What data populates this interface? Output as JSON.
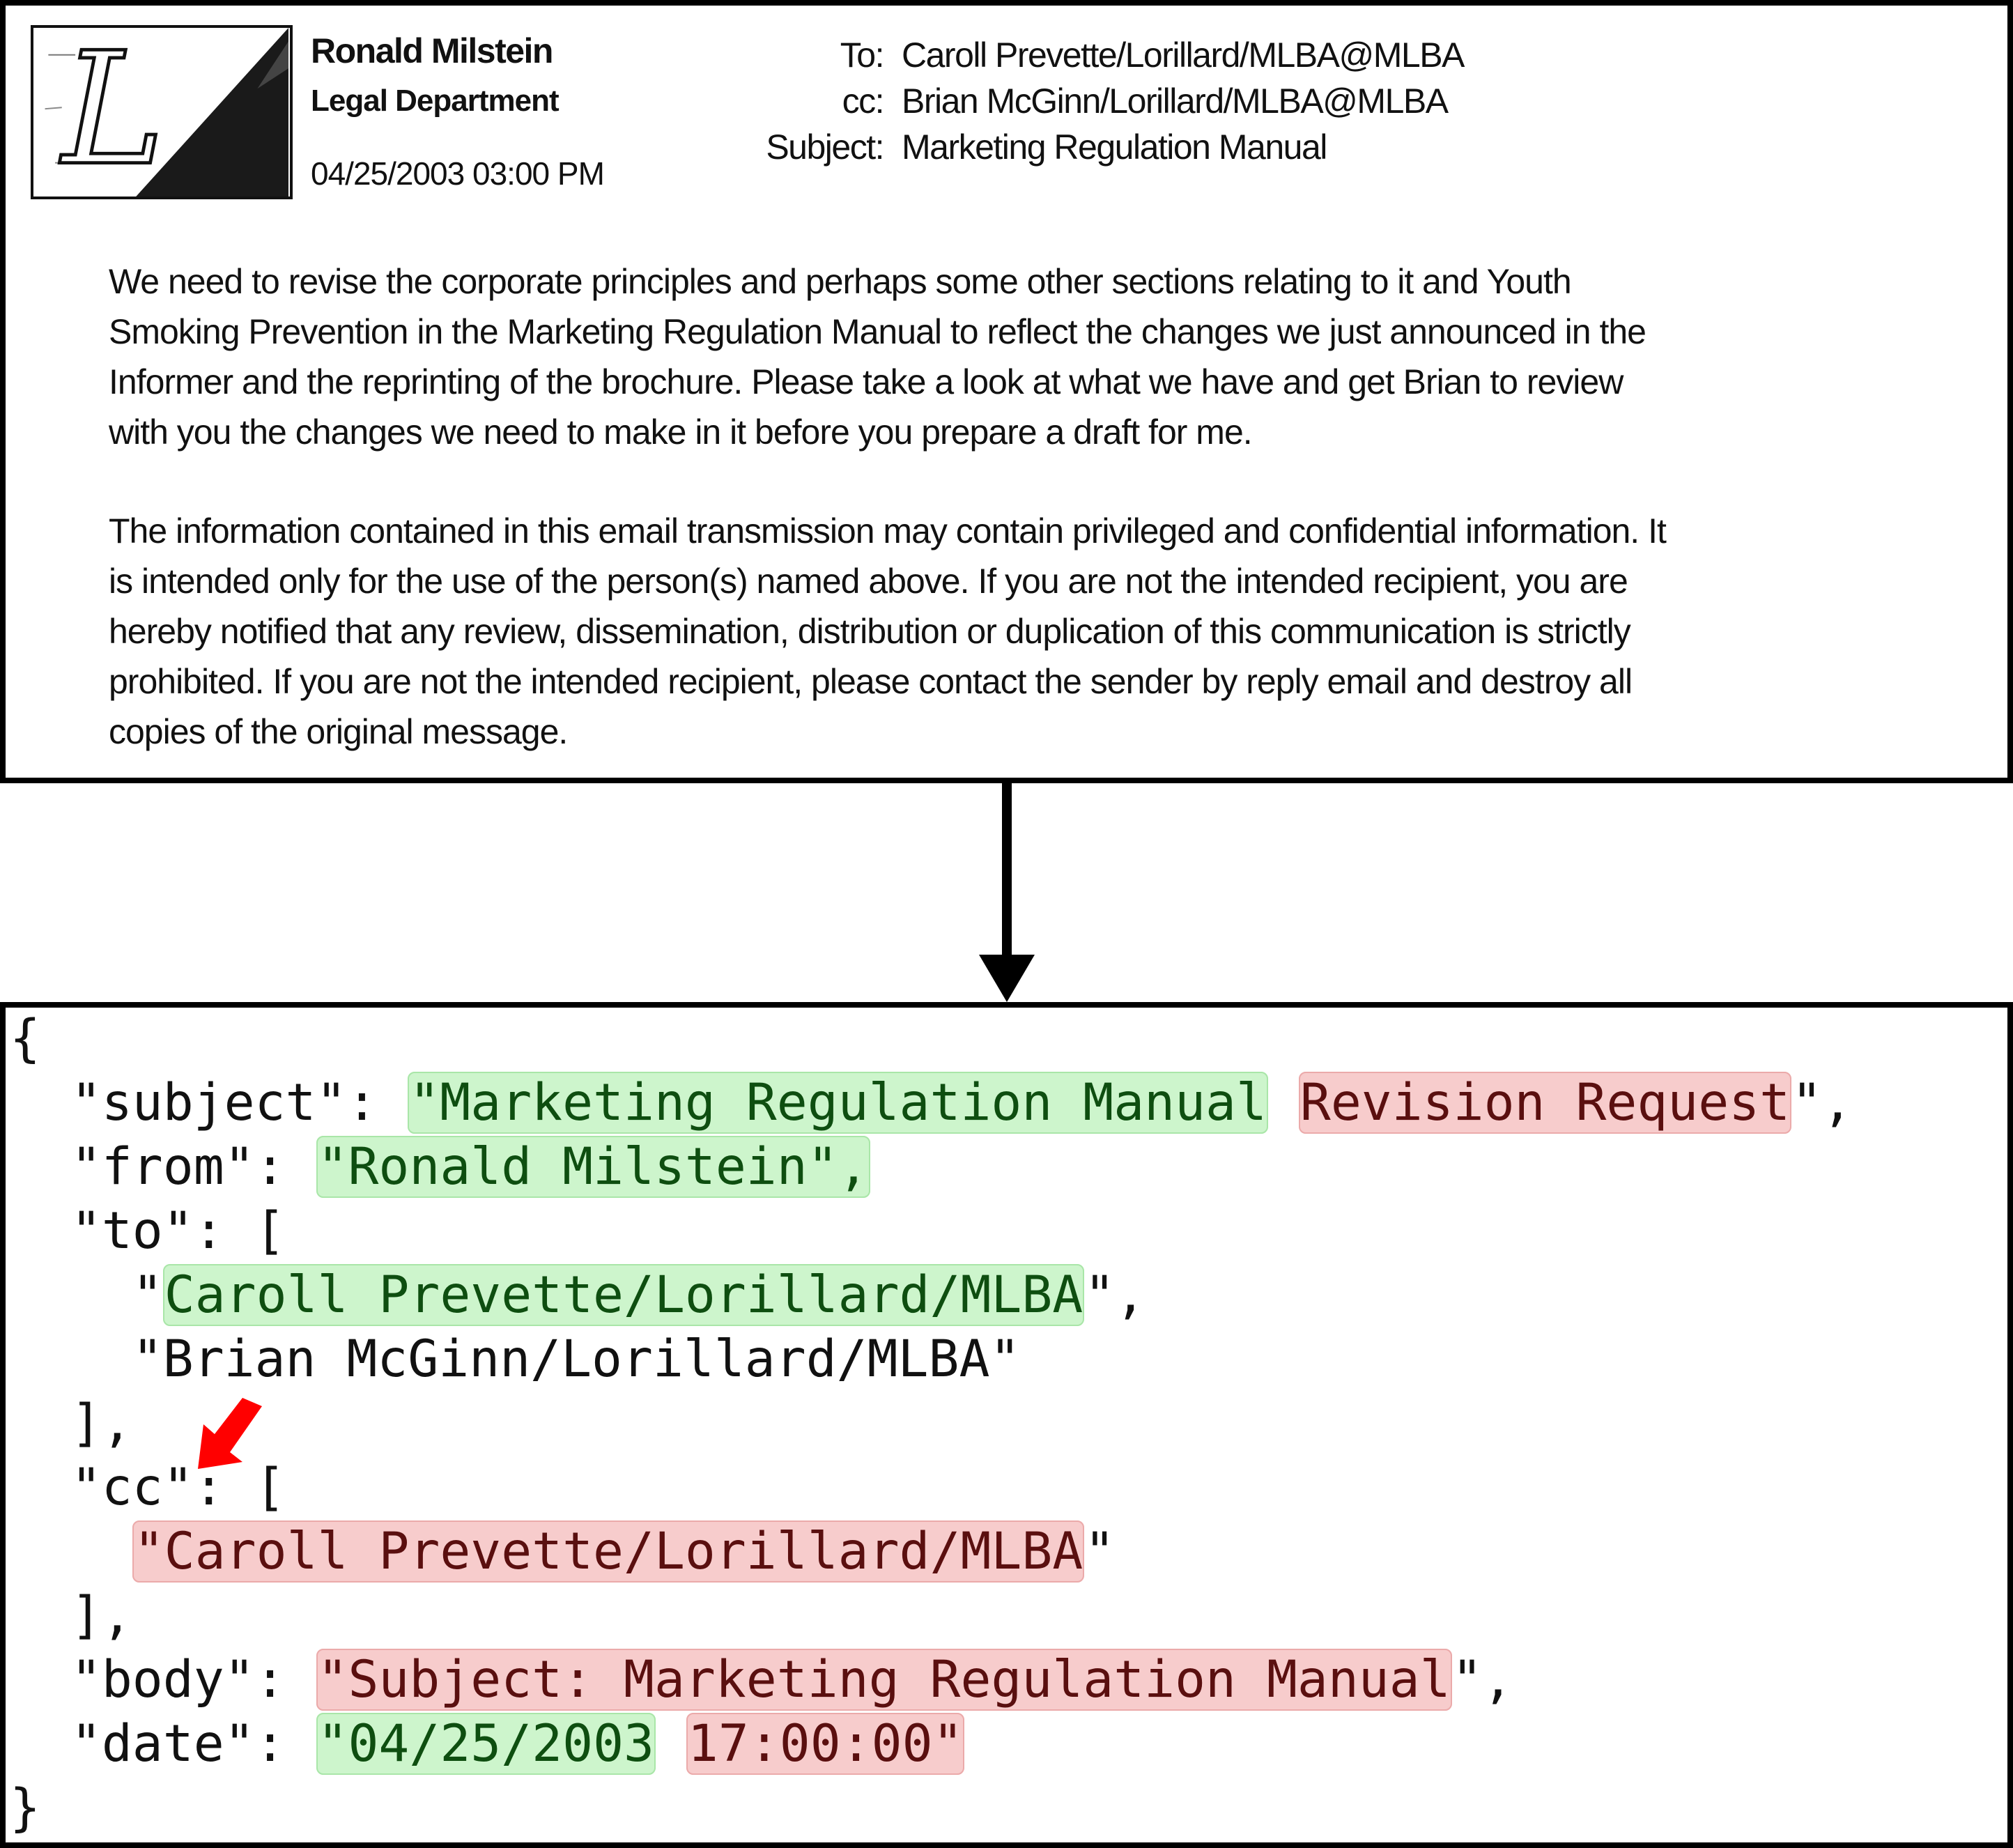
{
  "email": {
    "logo_letter": "L",
    "sender_name": "Ronald Milstein",
    "sender_department": "Legal Department",
    "sender_datetime": "04/25/2003 03:00 PM",
    "to_label": "To:",
    "to_value": "Caroll Prevette/Lorillard/MLBA@MLBA",
    "cc_label": "cc:",
    "cc_value": "Brian McGinn/Lorillard/MLBA@MLBA",
    "subject_label": "Subject:",
    "subject_value": "Marketing Regulation Manual",
    "paragraph1": [
      "We need to revise the corporate principles and perhaps some other sections relating to it and Youth",
      "Smoking Prevention in the Marketing Regulation Manual to reflect the changes we just announced in the",
      "Informer and the reprinting of the brochure.  Please take a look at what we have and get Brian to review",
      "with you the changes we need to make in it before you prepare a draft for me."
    ],
    "paragraph2": [
      "The information contained in this email transmission may contain privileged and confidential information.  It",
      "is intended only for the use of the person(s) named above.  If you are not the intended recipient, you are",
      "hereby notified that any review, dissemination, distribution or duplication of this communication is strictly",
      "prohibited.  If you are not the intended recipient, please contact the sender by reply email and destroy all",
      "copies of the original message."
    ]
  },
  "json_output": {
    "open_brace": "{",
    "subject_key": "\"subject\": ",
    "subject_correct": "\"Marketing Regulation Manual",
    "subject_wrong": "Revision Request",
    "subject_tail": "\",",
    "from_key": "\"from\": ",
    "from_value": "\"Ronald Milstein\",",
    "to_key": "\"to\": [",
    "to_item1_open": "\"",
    "to_item1_value": "Caroll Prevette/Lorillard/MLBA",
    "to_item1_close": "\",",
    "to_item2": "\"Brian McGinn/Lorillard/MLBA\"",
    "to_close": "],",
    "cc_key": "\"cc\": [",
    "cc_item_open": "\"",
    "cc_item_value": "Caroll Prevette/Lorillard/MLBA",
    "cc_item_close": "\"",
    "cc_close": "],",
    "body_key": "\"body\": ",
    "body_value": "\"Subject: Marketing Regulation Manual",
    "body_tail": "\",",
    "date_key": "\"date\": ",
    "date_correct": "\"04/25/2003",
    "date_wrong": "17:00:00\"",
    "close_brace": "}"
  },
  "colors": {
    "correct_highlight": "#cdf5cc",
    "wrong_highlight": "#f7cccc",
    "pointer_arrow": "#ff0000"
  }
}
